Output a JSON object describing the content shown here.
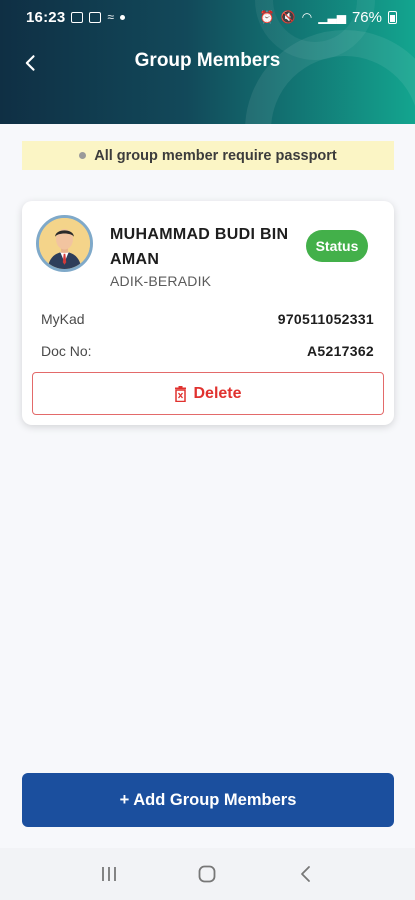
{
  "status_bar": {
    "time": "16:23",
    "battery": "76%"
  },
  "header": {
    "title": "Group Members"
  },
  "notice": {
    "text": "All group member require passport"
  },
  "member": {
    "name": "MUHAMMAD BUDI BIN AMAN",
    "relationship": "ADIK-BERADIK",
    "status_label": "Status",
    "status_color": "#43b04a",
    "fields": [
      {
        "label": "MyKad",
        "value": "970511052331"
      },
      {
        "label": "Doc No:",
        "value": "A5217362"
      }
    ],
    "delete_label": "Delete"
  },
  "actions": {
    "add_label": "+ Add Group Members"
  },
  "colors": {
    "primary": "#1b4f9e",
    "danger": "#e0322f",
    "notice_bg": "#fbf5c5",
    "header_start": "#0f2f44",
    "header_end": "#13a58f"
  },
  "icons": {
    "back": "arrow-left-icon",
    "delete": "trash-icon",
    "nav_recent": "recent-apps-icon",
    "nav_home": "home-icon",
    "nav_back": "back-icon"
  }
}
